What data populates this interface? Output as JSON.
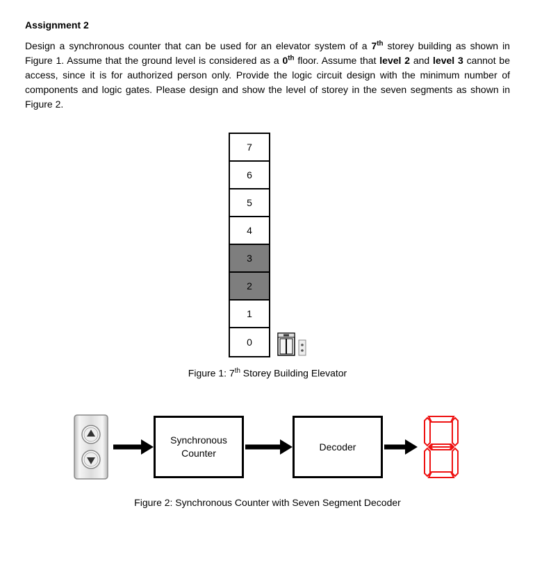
{
  "title": "Assignment 2",
  "paragraph_parts": {
    "p1": "Design a synchronous counter that can be used for an elevator system of a ",
    "b1": "7",
    "sup1": "th",
    "p2": " storey building as shown in Figure 1. Assume that the ground level is considered as a ",
    "b2": "0",
    "sup2": "th",
    "p3": " floor. Assume that ",
    "b3": "level 2",
    "p4": " and ",
    "b4": "level 3",
    "p5": " cannot be access, since it is for authorized person only. Provide the logic circuit design with the minimum number of components and logic gates. Please design and show the level of storey in the seven segments as shown in Figure 2."
  },
  "figure1": {
    "floors": [
      "7",
      "6",
      "5",
      "4",
      "3",
      "2",
      "1",
      "0"
    ],
    "restricted": [
      "2",
      "3"
    ],
    "caption_pre": "Figure 1: 7",
    "caption_sup": "th",
    "caption_post": " Storey Building Elevator"
  },
  "figure2": {
    "block1": "Synchronous Counter",
    "block2": "Decoder",
    "caption": "Figure 2: Synchronous Counter with Seven Segment Decoder"
  }
}
